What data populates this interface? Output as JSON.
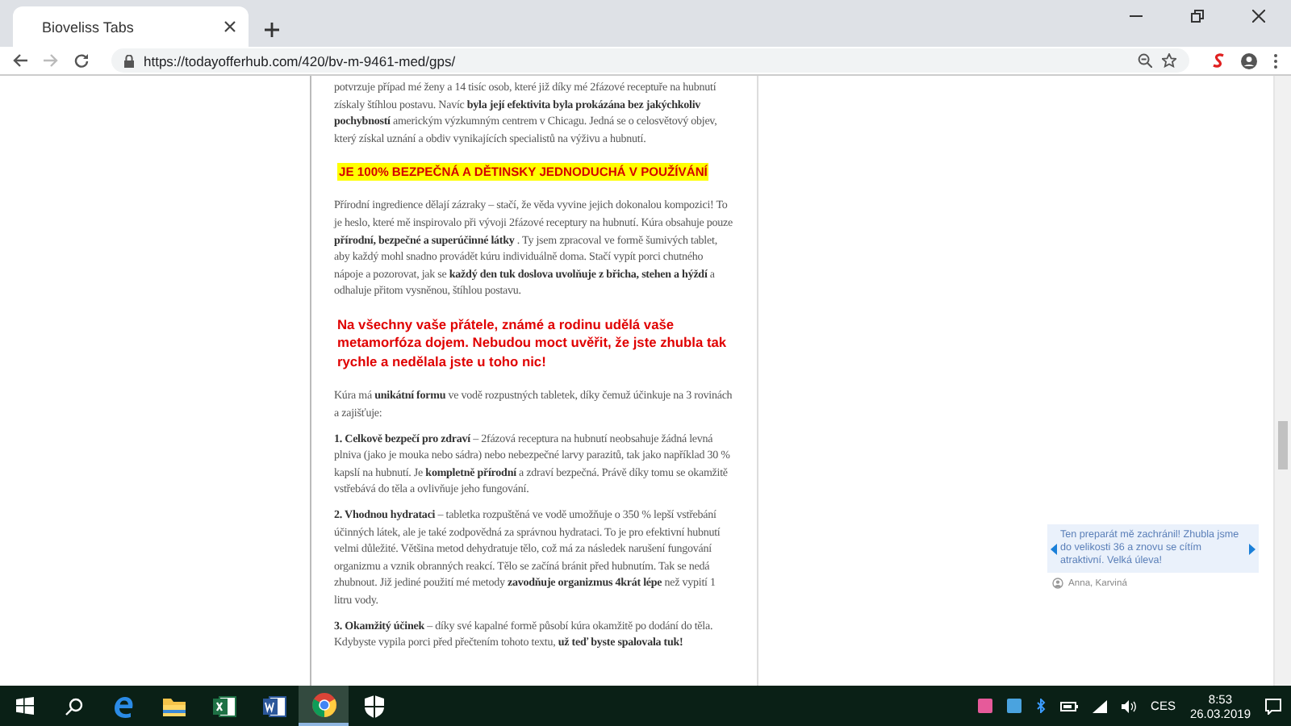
{
  "browser": {
    "tab": {
      "title": "Bioveliss Tabs"
    },
    "url": "https://todayofferhub.com/420/bv-m-9461-med/gps/"
  },
  "article": [
    {
      "kind": "paragraph",
      "text": "potvrzuje případ mé ženy a 14 tisíc osob, které již díky mé 2fázové receptuře na hubnutí získaly štíhlou postavu. Navíc **byla její efektivita byla prokázána bez jakýchkoliv pochybností** americkým výzkumným centrem v Chicagu. Jedná se o celosvětový objev, který získal uznání a obdiv vynikajících specialistů na výživu a hubnutí."
    },
    {
      "kind": "highlight",
      "text": "JE 100% BEZPEČNÁ A DĚTINSKY JEDNODUCHÁ V POUŽÍVÁNÍ"
    },
    {
      "kind": "paragraph",
      "text": "Přírodní ingredience dělají zázraky – stačí, že věda vyvine jejich dokonalou kompozici! To je heslo, které mě inspirovalo při vývoji 2fázové receptury na hubnutí. Kúra obsahuje pouze **přírodní, bezpečné a superúčinné látky** . Ty jsem zpracoval ve formě šumivých tablet, aby každý mohl snadno provádět kúru individuálně doma. Stačí vypít porci chutného nápoje a pozorovat, jak se **každý den tuk doslova uvolňuje z břicha, stehen a hýždí** a odhaluje přitom vysněnou, štíhlou postavu."
    },
    {
      "kind": "callout",
      "text": "Na všechny vaše přátele, známé a rodinu udělá vaše metamorfóza dojem. Nebudou moct uvěřit, že jste zhubla tak rychle a nedělala jste u toho nic!"
    },
    {
      "kind": "paragraph",
      "text": "Kúra má **unikátní formu** ve vodě rozpustných tabletek, díky čemuž účinkuje na 3 rovinách a zajišťuje:"
    },
    {
      "kind": "paragraph",
      "text": "**1. Celkově bezpečí pro zdraví** – 2fázová receptura na hubnutí neobsahuje žádná levná plniva (jako je mouka nebo sádra) nebo nebezpečné larvy parazitů, tak jako například 30 % kapslí na hubnutí. Je **kompletně přírodní** a zdraví bezpečná. Právě díky tomu se okamžitě vstřebává do těla a ovlivňuje jeho fungování."
    },
    {
      "kind": "paragraph",
      "text": "**2. Vhodnou hydrataci** – tabletka rozpuštěná ve vodě umožňuje o 350 % lepší vstřebání účinných látek, ale je také zodpovědná za správnou hydrataci. To je pro efektivní hubnutí velmi důležité. Většina metod dehydratuje tělo, což má za následek narušení fungování organizmu a vznik obranných reakcí. Tělo se začíná bránit před hubnutím. Tak se nedá zhubnout. Již jediné použití mé metody **zavodňuje organizmus 4krát lépe** než vypití 1 litru vody."
    },
    {
      "kind": "paragraph",
      "text": "**3. Okamžitý účinek** – díky své kapalné formě působí kúra okamžitě po dodání do těla. Kdybyste vypila porci před přečtením tohoto textu, **už teď byste spalovala tuk!**"
    }
  ],
  "testimonial": {
    "text": "Ten preparát mě zachránil! Zhubla jsme do velikosti 36 a znovu se cítím atraktivní. Velká úleva!",
    "author": "Anna, Karviná"
  },
  "taskbar": {
    "apps": [
      {
        "kind": "search",
        "selected": false
      },
      {
        "kind": "edge",
        "selected": false
      },
      {
        "kind": "folder",
        "selected": false
      },
      {
        "kind": "excel",
        "selected": false
      },
      {
        "kind": "word",
        "selected": false
      },
      {
        "kind": "chrome",
        "selected": true
      },
      {
        "kind": "shield",
        "selected": false
      }
    ],
    "language": "CES",
    "time": "8:53",
    "date": "26.03.2019"
  }
}
